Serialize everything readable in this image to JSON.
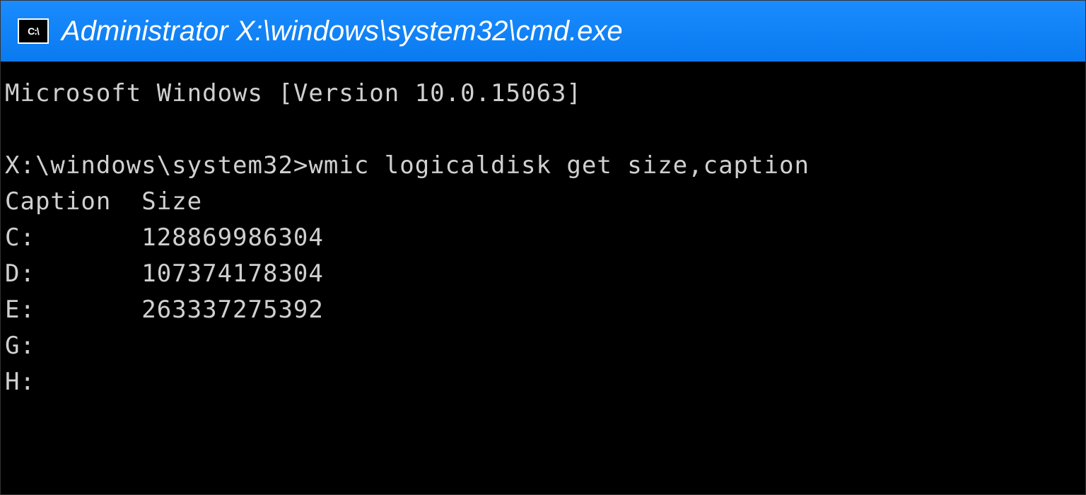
{
  "window": {
    "icon_label": "C:\\",
    "title": "Administrator X:\\windows\\system32\\cmd.exe"
  },
  "terminal": {
    "version_line": "Microsoft Windows [Version 10.0.15063]",
    "prompt": "X:\\windows\\system32>",
    "command": "wmic logicaldisk get size,caption",
    "header": "Caption  Size",
    "rows": [
      "C:       128869986304",
      "D:       107374178304",
      "E:       263337275392",
      "G:",
      "H:"
    ]
  }
}
